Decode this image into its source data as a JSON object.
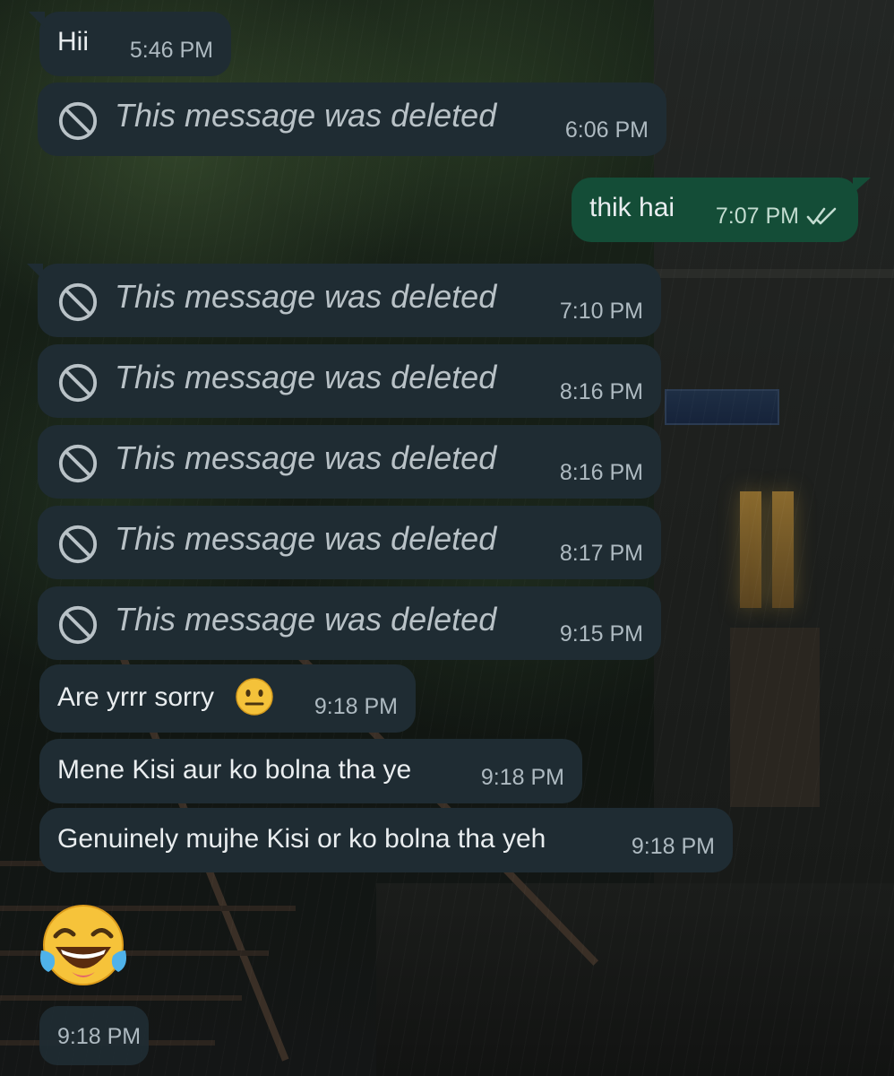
{
  "messages": [
    {
      "direction": "in",
      "type": "text",
      "text": "Hii",
      "time": "5:46 PM"
    },
    {
      "direction": "in",
      "type": "deleted",
      "text": "This message was deleted",
      "time": "6:06 PM",
      "icon": "ban-icon"
    },
    {
      "direction": "out",
      "type": "text",
      "text": "thik hai",
      "time": "7:07 PM",
      "status": "read-double-check-icon"
    },
    {
      "direction": "in",
      "type": "deleted",
      "text": "This message was deleted",
      "time": "7:10 PM",
      "icon": "ban-icon"
    },
    {
      "direction": "in",
      "type": "deleted",
      "text": "This message was deleted",
      "time": "8:16 PM",
      "icon": "ban-icon"
    },
    {
      "direction": "in",
      "type": "deleted",
      "text": "This message was deleted",
      "time": "8:16 PM",
      "icon": "ban-icon"
    },
    {
      "direction": "in",
      "type": "deleted",
      "text": "This message was deleted",
      "time": "8:17 PM",
      "icon": "ban-icon"
    },
    {
      "direction": "in",
      "type": "deleted",
      "text": "This message was deleted",
      "time": "9:15 PM",
      "icon": "ban-icon"
    },
    {
      "direction": "in",
      "type": "text",
      "text": "Are yrrr sorry",
      "emoji": "neutral-face-emoji",
      "time": "9:18 PM"
    },
    {
      "direction": "in",
      "type": "text",
      "text": "Mene Kisi aur ko bolna tha ye",
      "time": "9:18 PM"
    },
    {
      "direction": "in",
      "type": "text",
      "text": "Genuinely mujhe Kisi or ko bolna tha yeh",
      "time": "9:18 PM"
    },
    {
      "direction": "in",
      "type": "emoji",
      "emoji": "face-with-tears-of-joy-emoji",
      "time": "9:18 PM"
    }
  ],
  "colors": {
    "incoming_bubble": "#1f2c33",
    "outgoing_bubble": "#144d37",
    "text": "#e9edef",
    "timestamp": "#aebac1",
    "read_ticks": "#c3dcd0"
  }
}
